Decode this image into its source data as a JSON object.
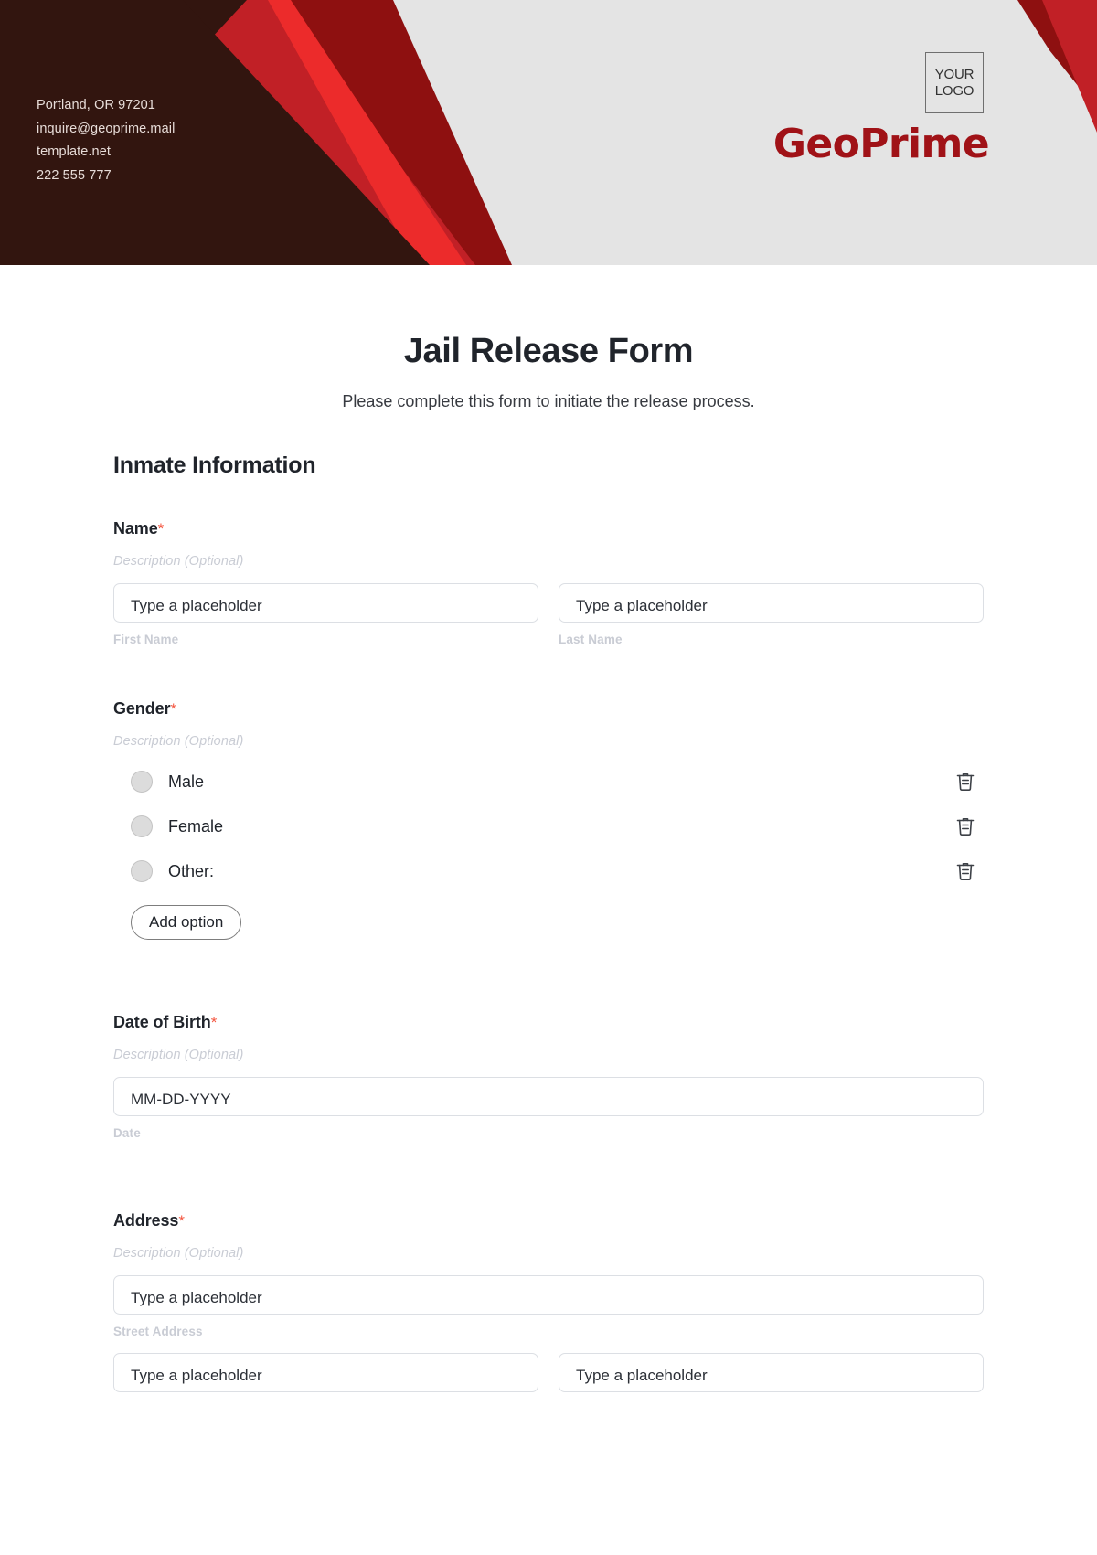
{
  "header": {
    "contact_lines": [
      "Portland, OR 97201",
      "inquire@geoprime.mail",
      "template.net",
      "222 555 777"
    ],
    "logo_line1": "YOUR",
    "logo_line2": "LOGO",
    "brand": "GeoPrime",
    "colors": {
      "background": "#e4e4e4",
      "dark_maroon": "#32150f",
      "deep_red": "#8e1010",
      "mid_red": "#c12026",
      "bright_red": "#ec2b2b",
      "brand_red": "#a01217"
    }
  },
  "page": {
    "title": "Jail Release Form",
    "subtitle": "Please complete this form to initiate the release process.",
    "section_title": "Inmate Information",
    "required_mark": "*",
    "description_placeholder": "Description (Optional)"
  },
  "fields": {
    "name": {
      "label": "Name",
      "description": "Description (Optional)",
      "first": {
        "placeholder": "Type a placeholder",
        "sublabel": "First Name"
      },
      "last": {
        "placeholder": "Type a placeholder",
        "sublabel": "Last Name"
      }
    },
    "gender": {
      "label": "Gender",
      "description": "Description (Optional)",
      "options": [
        {
          "label": "Male",
          "delete_icon": "trash-icon"
        },
        {
          "label": "Female",
          "delete_icon": "trash-icon"
        },
        {
          "label": "Other:",
          "delete_icon": "trash-icon"
        }
      ],
      "add_option_label": "Add option"
    },
    "dob": {
      "label": "Date of Birth",
      "description": "Description (Optional)",
      "placeholder": "MM-DD-YYYY",
      "sublabel": "Date"
    },
    "address": {
      "label": "Address",
      "description": "Description (Optional)",
      "street": {
        "placeholder": "Type a placeholder",
        "sublabel": "Street Address"
      },
      "line2": {
        "placeholder": "Type a placeholder"
      },
      "line3": {
        "placeholder": "Type a placeholder"
      }
    }
  }
}
